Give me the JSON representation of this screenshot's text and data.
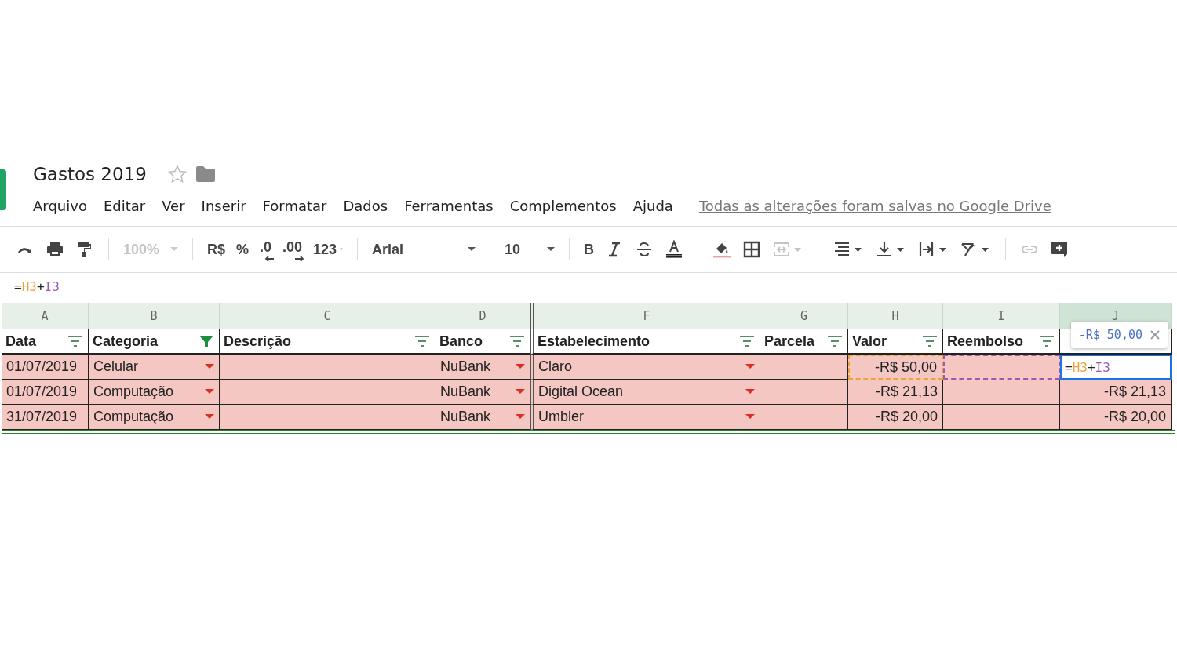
{
  "document": {
    "title": "Gastos 2019",
    "starred": false
  },
  "menu": [
    "Arquivo",
    "Editar",
    "Ver",
    "Inserir",
    "Formatar",
    "Dados",
    "Ferramentas",
    "Complementos",
    "Ajuda"
  ],
  "save_status": "Todas as alterações foram salvas no Google Drive",
  "toolbar": [
    {
      "kind": "redo",
      "disabled": false
    },
    {
      "kind": "print",
      "disabled": false
    },
    {
      "kind": "paintformat",
      "disabled": false
    },
    {
      "kind": "separator"
    },
    {
      "kind": "select",
      "label": "100%",
      "disabled": true
    },
    {
      "kind": "separator"
    },
    {
      "kind": "text",
      "label": "R$",
      "disabled": false
    },
    {
      "kind": "text",
      "label": "%",
      "disabled": false
    },
    {
      "kind": "decdecimal",
      "label": ".0",
      "disabled": false
    },
    {
      "kind": "incdecimal",
      "label": ".00",
      "disabled": false
    },
    {
      "kind": "select",
      "label": "123",
      "disabled": false
    },
    {
      "kind": "separator"
    },
    {
      "kind": "select",
      "label": "Arial",
      "disabled": false
    },
    {
      "kind": "separator"
    },
    {
      "kind": "select",
      "label": "10",
      "disabled": false
    },
    {
      "kind": "separator"
    },
    {
      "kind": "text",
      "label": "B",
      "disabled": false
    },
    {
      "kind": "italic",
      "disabled": false
    },
    {
      "kind": "strike",
      "disabled": false
    },
    {
      "kind": "textcolor",
      "disabled": false
    },
    {
      "kind": "separator"
    },
    {
      "kind": "fillcolor",
      "disabled": false
    },
    {
      "kind": "borders",
      "disabled": false
    },
    {
      "kind": "merge",
      "disabled": true
    },
    {
      "kind": "separator"
    },
    {
      "kind": "halign",
      "disabled": false
    },
    {
      "kind": "valign",
      "disabled": false
    },
    {
      "kind": "wrap",
      "disabled": false
    },
    {
      "kind": "rotate",
      "disabled": false
    },
    {
      "kind": "separator"
    },
    {
      "kind": "link",
      "disabled": true
    },
    {
      "kind": "comment",
      "disabled": false
    }
  ],
  "formula_bar": [
    {
      "text": "=",
      "color": "#202124"
    },
    {
      "text": "H3",
      "color": "#e8a33c"
    },
    {
      "text": "+",
      "color": "#202124"
    },
    {
      "text": "I3",
      "color": "#9b59b6"
    }
  ],
  "columns": [
    {
      "letter": "A",
      "header": "Data",
      "filter_active": false,
      "selected": false,
      "dropdown": false,
      "hidden_before": false
    },
    {
      "letter": "B",
      "header": "Categoria",
      "filter_active": true,
      "selected": false,
      "dropdown": true,
      "hidden_before": false
    },
    {
      "letter": "C",
      "header": "Descrição",
      "filter_active": false,
      "selected": false,
      "dropdown": false,
      "hidden_before": false
    },
    {
      "letter": "D",
      "header": "Banco",
      "filter_active": false,
      "selected": false,
      "dropdown": true,
      "hidden_before": false
    },
    {
      "letter": "F",
      "header": "Estabelecimento",
      "filter_active": false,
      "selected": false,
      "dropdown": true,
      "hidden_before": true
    },
    {
      "letter": "G",
      "header": "Parcela",
      "filter_active": false,
      "selected": false,
      "dropdown": false,
      "hidden_before": false
    },
    {
      "letter": "H",
      "header": "Valor",
      "filter_active": false,
      "selected": false,
      "dropdown": false,
      "hidden_before": false
    },
    {
      "letter": "I",
      "header": "Reembolso",
      "filter_active": false,
      "selected": false,
      "dropdown": false,
      "hidden_before": false
    },
    {
      "letter": "J",
      "filter_active": false,
      "selected": true,
      "dropdown": false,
      "hidden_before": false
    }
  ],
  "rows": [
    {
      "cells": [
        {
          "text": "01/07/2019"
        },
        {
          "text": "Celular"
        },
        {},
        {
          "text": "NuBank"
        },
        {
          "text": "Claro"
        },
        {},
        {
          "text": "-R$ 50,00",
          "color": "#e8a33c"
        },
        {
          "color": "#9b59b6"
        },
        {
          "editing": true,
          "formula": [
            {
              "text": "=",
              "color": "#202124"
            },
            {
              "text": "H3",
              "color": "#e8a33c"
            },
            {
              "text": "+",
              "color": "#202124"
            },
            {
              "text": "I3",
              "color": "#9b59b6"
            }
          ],
          "preview": "-R$ 50,00"
        }
      ]
    },
    {
      "cells": [
        {
          "text": "01/07/2019"
        },
        {
          "text": "Computação"
        },
        {},
        {
          "text": "NuBank"
        },
        {
          "text": "Digital Ocean"
        },
        {},
        {
          "text": "-R$ 21,13"
        },
        {},
        {
          "text": "-R$ 21,13"
        }
      ]
    },
    {
      "cells": [
        {
          "text": "31/07/2019"
        },
        {
          "text": "Computação"
        },
        {},
        {
          "text": "NuBank"
        },
        {
          "text": "Umbler"
        },
        {},
        {
          "text": "-R$ 20,00"
        },
        {},
        {
          "text": "-R$ 20,00"
        }
      ]
    }
  ]
}
